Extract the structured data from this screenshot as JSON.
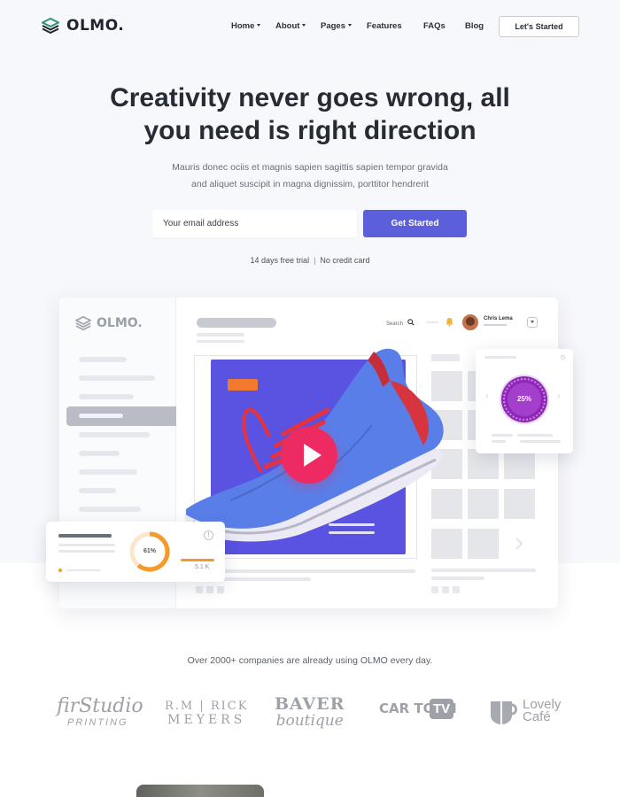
{
  "nav": {
    "logo": "OLMO.",
    "items": [
      {
        "label": "Home",
        "dropdown": true
      },
      {
        "label": "About",
        "dropdown": true
      },
      {
        "label": "Pages",
        "dropdown": true
      },
      {
        "label": "Features",
        "dropdown": false
      },
      {
        "label": "FAQs",
        "dropdown": false
      },
      {
        "label": "Blog",
        "dropdown": false
      }
    ],
    "cta": "Let's Started"
  },
  "hero": {
    "headline_line1": "Creativity never goes wrong, all",
    "headline_line2": "you need is right direction",
    "subtext_line1": "Mauris donec ociis et magnis sapien sagittis sapien tempor gravida",
    "subtext_line2": "and aliquet suscipit in magna dignissim, porttitor hendrerit",
    "email_placeholder": "Your email address",
    "cta": "Get Started",
    "trial": "14 days free trial",
    "no_card": "No credit card"
  },
  "mockup": {
    "logo": "OLMO.",
    "search_label": "Search",
    "user_name": "Chris Lema",
    "progress_right": "25%",
    "progress_left": "61%",
    "stat_value": "5.1 K"
  },
  "colors": {
    "accent": "#5b5fdc",
    "play": "#ee2a62",
    "orange": "#f39a2b",
    "purple": "#7a1fa2"
  },
  "companies": {
    "caption": "Over 2000+ companies are already using OLMO every day.",
    "logos": [
      {
        "line1": "firStudio",
        "line2": "PRINTING"
      },
      {
        "line1": "R.M | RICK",
        "line2": "MEYERS"
      },
      {
        "line1": "BAVER",
        "line2": "boutique"
      },
      {
        "line1": "CAR TOON",
        "line2": "TV"
      },
      {
        "line1": "Lovely",
        "line2": "Café"
      }
    ]
  }
}
